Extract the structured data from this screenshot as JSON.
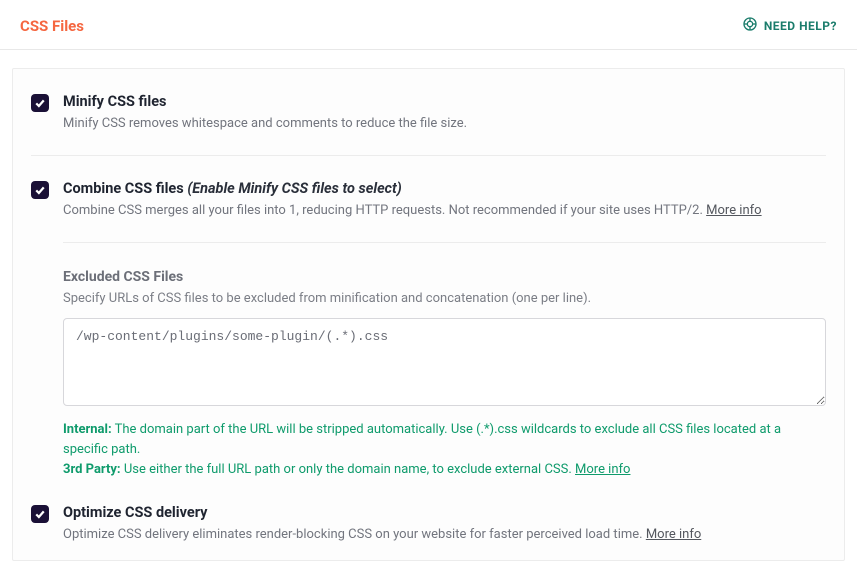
{
  "header": {
    "title": "CSS Files",
    "help_label": "NEED HELP?"
  },
  "minify": {
    "title": "Minify CSS files",
    "desc": "Minify CSS removes whitespace and comments to reduce the file size."
  },
  "combine": {
    "title": "Combine CSS files",
    "hint": "(Enable Minify CSS files to select)",
    "desc": "Combine CSS merges all your files into 1, reducing HTTP requests. Not recommended if your site uses HTTP/2.",
    "more_info": "More info"
  },
  "exclude": {
    "title": "Excluded CSS Files",
    "desc": "Specify URLs of CSS files to be excluded from minification and concatenation (one per line).",
    "value": "/wp-content/plugins/some-plugin/(.*).css",
    "notice_internal_label": "Internal:",
    "notice_internal_text": "The domain part of the URL will be stripped automatically. Use (.*).css wildcards to exclude all CSS files located at a specific path.",
    "notice_3rd_label": "3rd Party:",
    "notice_3rd_text": "Use either the full URL path or only the domain name, to exclude external CSS.",
    "more_info": "More info"
  },
  "optimize": {
    "title": "Optimize CSS delivery",
    "desc": "Optimize CSS delivery eliminates render-blocking CSS on your website for faster perceived load time.",
    "more_info": "More info"
  }
}
